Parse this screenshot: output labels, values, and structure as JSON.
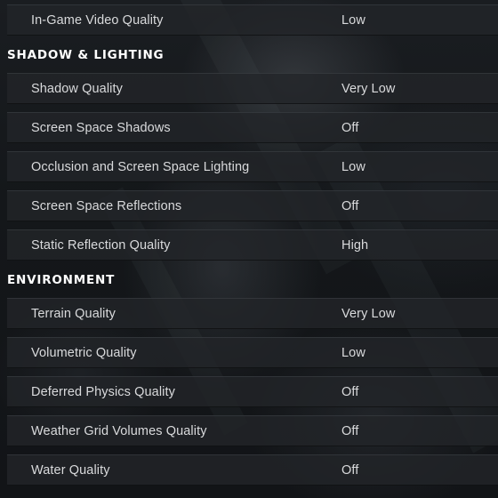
{
  "sections": [
    {
      "rows": [
        {
          "label": "In-Game Video Quality",
          "value": "Low"
        }
      ]
    },
    {
      "title": "SHADOW & LIGHTING",
      "rows": [
        {
          "label": "Shadow Quality",
          "value": "Very Low"
        },
        {
          "label": "Screen Space Shadows",
          "value": "Off"
        },
        {
          "label": "Occlusion and Screen Space Lighting",
          "value": "Low"
        },
        {
          "label": "Screen Space Reflections",
          "value": "Off"
        },
        {
          "label": "Static Reflection Quality",
          "value": "High"
        }
      ]
    },
    {
      "title": "ENVIRONMENT",
      "rows": [
        {
          "label": "Terrain Quality",
          "value": "Very Low"
        },
        {
          "label": "Volumetric Quality",
          "value": "Low"
        },
        {
          "label": "Deferred Physics Quality",
          "value": "Off"
        },
        {
          "label": "Weather Grid Volumes Quality",
          "value": "Off"
        },
        {
          "label": "Water Quality",
          "value": "Off"
        }
      ]
    }
  ]
}
